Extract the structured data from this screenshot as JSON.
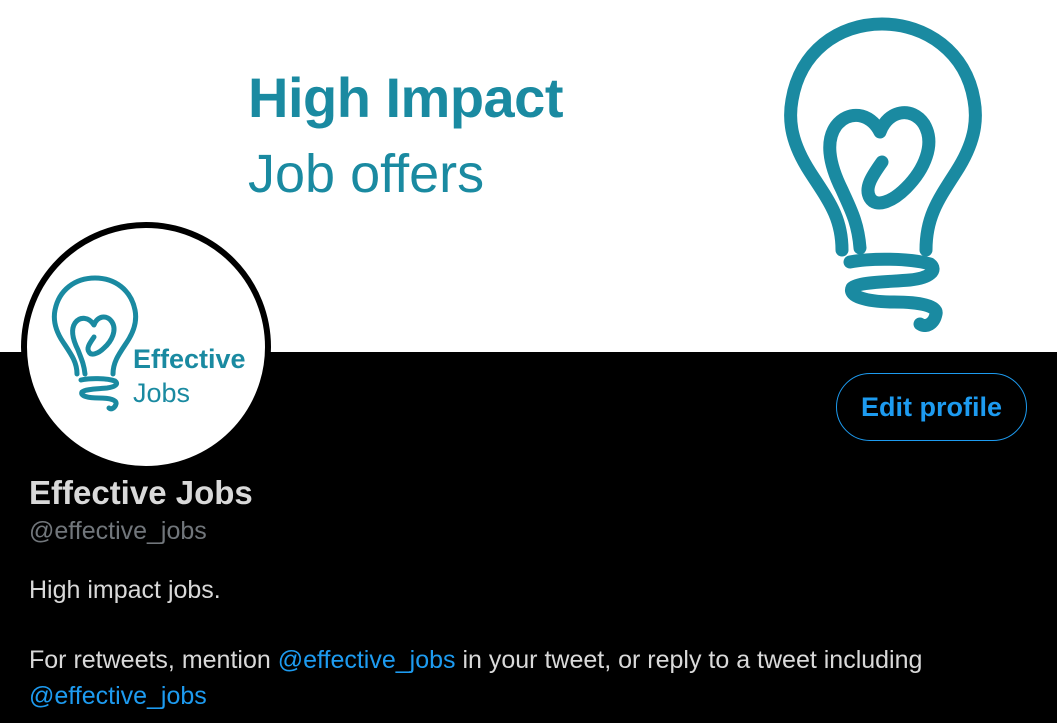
{
  "banner": {
    "title": "High Impact",
    "subtitle": "Job offers",
    "icon": "lightbulb-heart-icon"
  },
  "avatar": {
    "icon": "lightbulb-heart-icon",
    "word1": "Effective",
    "word2": "Jobs"
  },
  "actions": {
    "edit_profile_label": "Edit profile"
  },
  "profile": {
    "display_name": "Effective Jobs",
    "handle": "@effective_jobs"
  },
  "bio": {
    "line1": "High impact jobs.",
    "line2_part1": "For retweets, mention ",
    "line2_mention": "@effective_jobs",
    "line2_part2": " in your tweet, or reply to a tweet including",
    "line3_mention": "@effective_jobs"
  },
  "colors": {
    "brand_teal": "#1a8aa1",
    "accent_blue": "#1d9bf0",
    "background": "#000000",
    "text_primary": "#d9d9d9",
    "text_secondary": "#71767b"
  }
}
